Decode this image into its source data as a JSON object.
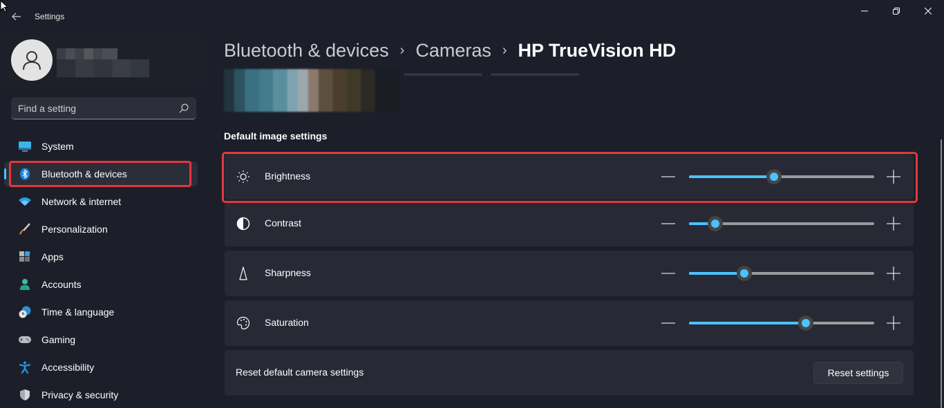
{
  "window": {
    "title": "Settings",
    "back_icon": "arrow-left-icon",
    "controls": [
      "minimize",
      "restore",
      "close"
    ]
  },
  "profile": {
    "avatar_icon": "person-icon",
    "name": "",
    "email": ""
  },
  "search": {
    "placeholder": "Find a setting",
    "value": ""
  },
  "sidebar": {
    "items": [
      {
        "label": "System",
        "icon": "monitor-icon",
        "active": false
      },
      {
        "label": "Bluetooth & devices",
        "icon": "bluetooth-icon",
        "active": true
      },
      {
        "label": "Network & internet",
        "icon": "wifi-icon",
        "active": false
      },
      {
        "label": "Personalization",
        "icon": "brush-icon",
        "active": false
      },
      {
        "label": "Apps",
        "icon": "apps-icon",
        "active": false
      },
      {
        "label": "Accounts",
        "icon": "account-icon",
        "active": false
      },
      {
        "label": "Time & language",
        "icon": "clock-globe-icon",
        "active": false
      },
      {
        "label": "Gaming",
        "icon": "gamepad-icon",
        "active": false
      },
      {
        "label": "Accessibility",
        "icon": "accessibility-icon",
        "active": false
      },
      {
        "label": "Privacy & security",
        "icon": "shield-icon",
        "active": false
      }
    ]
  },
  "breadcrumb": {
    "items": [
      "Bluetooth & devices",
      "Cameras",
      "HP TrueVision HD"
    ],
    "separator": "›"
  },
  "main": {
    "section_title": "Default image settings",
    "settings": [
      {
        "label": "Brightness",
        "icon": "sun-icon",
        "value_percent": 46,
        "highlighted": true
      },
      {
        "label": "Contrast",
        "icon": "contrast-icon",
        "value_percent": 14,
        "highlighted": false
      },
      {
        "label": "Sharpness",
        "icon": "sharpness-icon",
        "value_percent": 30,
        "highlighted": false
      },
      {
        "label": "Saturation",
        "icon": "palette-icon",
        "value_percent": 63,
        "highlighted": false
      }
    ],
    "reset": {
      "label": "Reset default camera settings",
      "button": "Reset settings"
    }
  },
  "colors": {
    "accent": "#4cc2ff",
    "highlight": "#e0393e",
    "background": "#1c1f29",
    "card": "#272a35"
  }
}
